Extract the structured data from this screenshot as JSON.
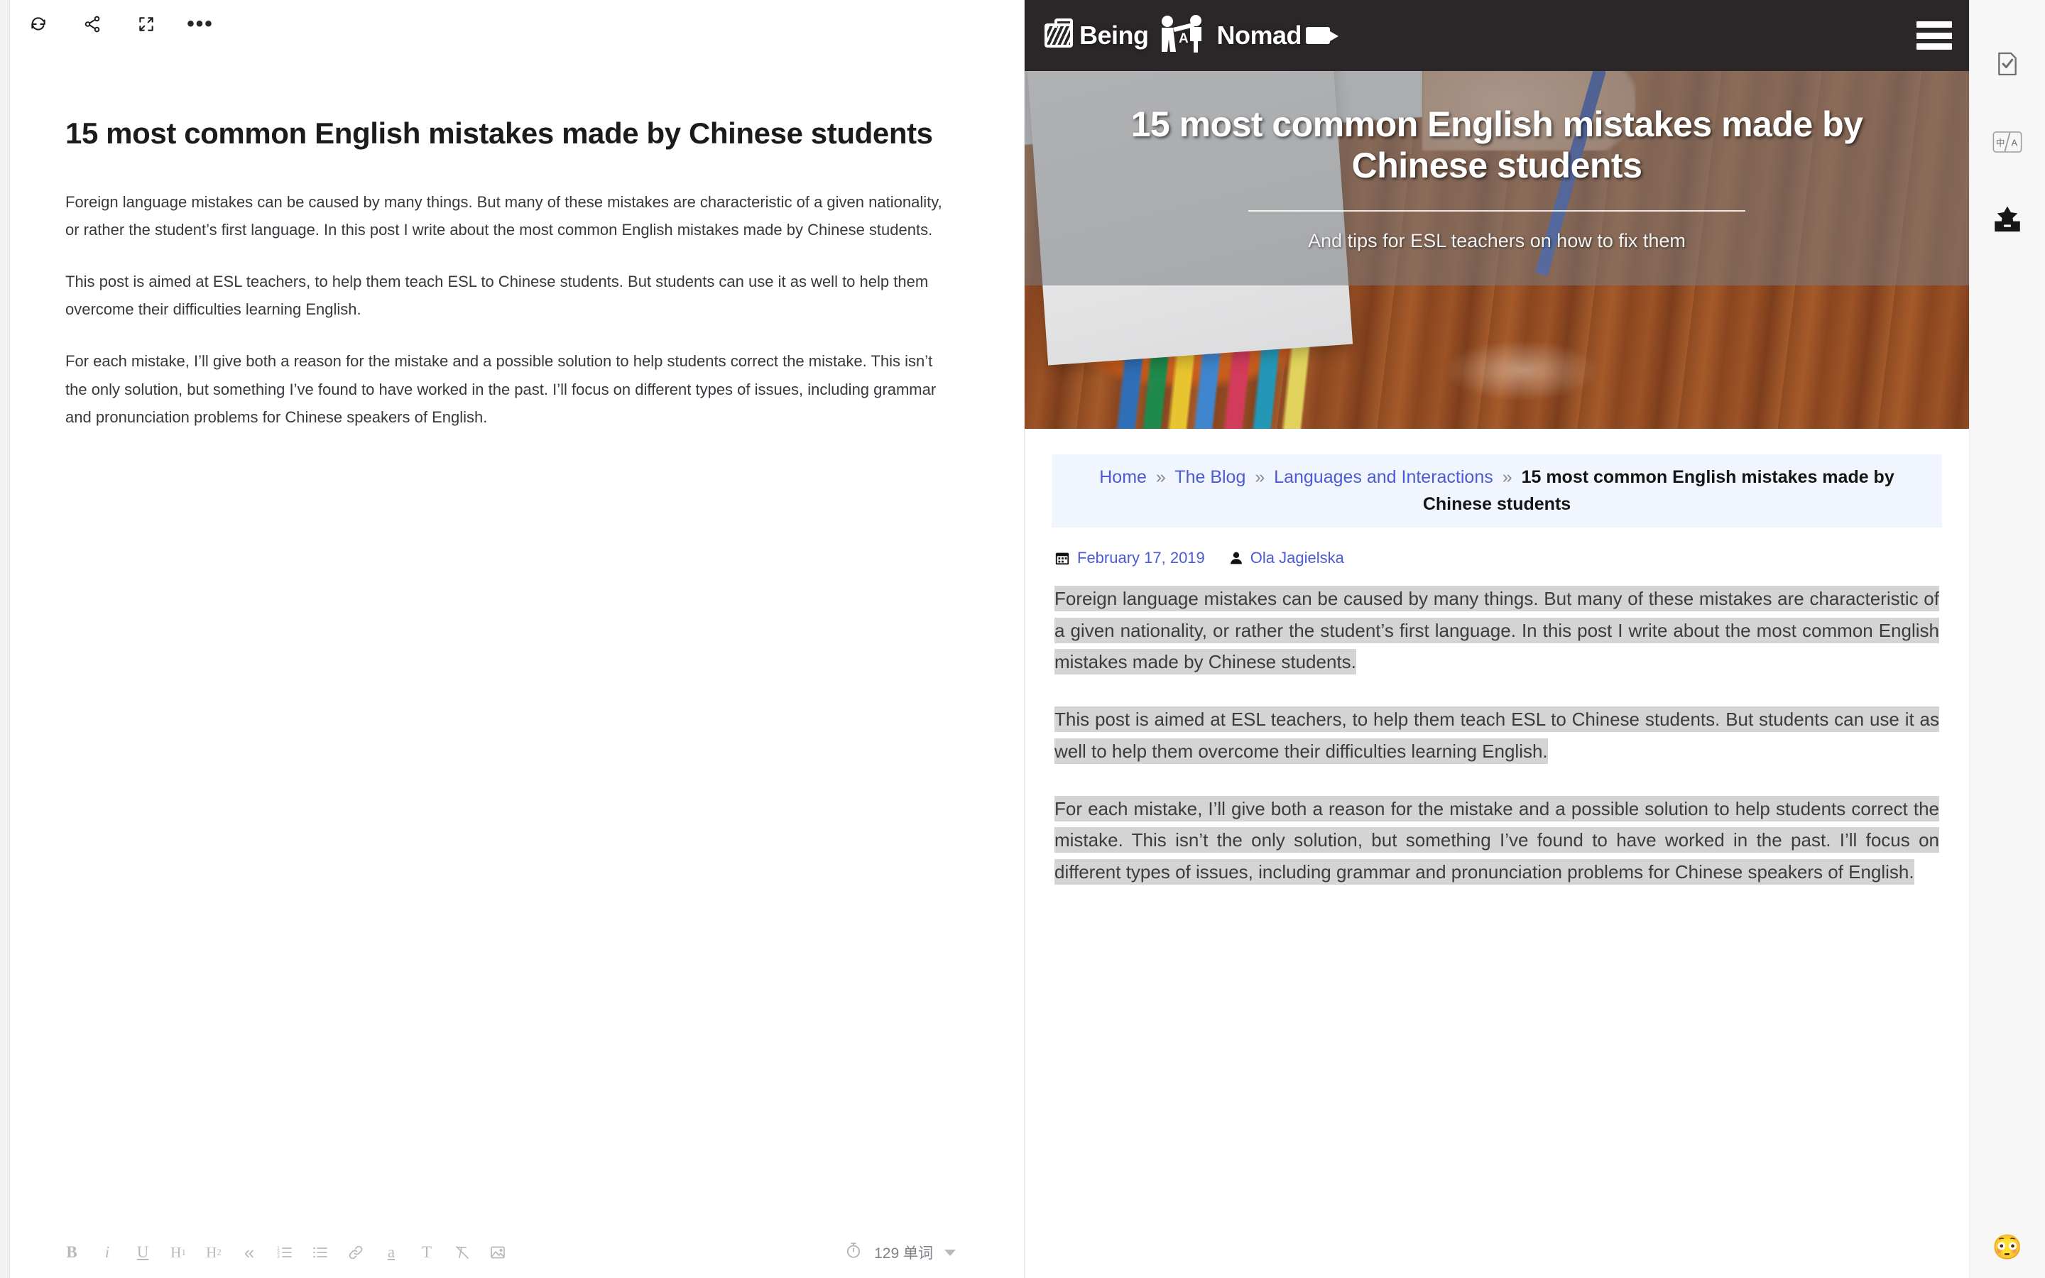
{
  "editor": {
    "toolbar": {
      "refresh_label": "sync",
      "share_label": "share",
      "fullscreen_label": "fullscreen",
      "more_label": "•••"
    },
    "title": "15 most common English mistakes made by Chinese students",
    "paragraphs": [
      "Foreign language mistakes can be caused by many things. But many of these mistakes are characteristic of a given nationality, or rather the student’s first language. In this post I write about the most common English mistakes made by Chinese students.",
      "This post is aimed at ESL teachers, to help them teach ESL to Chinese students. But students can use it as well to help them overcome their difficulties learning English.",
      "For each mistake, I’ll give both a reason for the mistake and a possible solution to help students correct the mistake. This isn’t the only solution, but something I’ve found to have worked in the past. I’ll focus on different types of issues, including grammar and pronunciation problems for Chinese speakers of English."
    ],
    "format_toolbar": [
      {
        "name": "bold",
        "label": "B"
      },
      {
        "name": "italic",
        "label": "i"
      },
      {
        "name": "underline",
        "label": "U"
      },
      {
        "name": "heading-1",
        "label": "H1"
      },
      {
        "name": "heading-2",
        "label": "H2"
      },
      {
        "name": "blockquote",
        "label": "«"
      },
      {
        "name": "ordered-list",
        "label": "ol"
      },
      {
        "name": "bullet-list",
        "label": "ul"
      },
      {
        "name": "link",
        "label": "link"
      },
      {
        "name": "highlight",
        "label": "a"
      },
      {
        "name": "text-style",
        "label": "T"
      },
      {
        "name": "clear-format",
        "label": "clear"
      },
      {
        "name": "insert-image",
        "label": "image"
      }
    ],
    "status": {
      "timer_label": "timer",
      "word_count": "129 单词"
    }
  },
  "site": {
    "logo_text_1": "Being",
    "logo_letter": "A",
    "logo_text_2": "Nomad",
    "menu_label": "menu",
    "hero": {
      "title": "15 most common English mistakes made by Chinese students",
      "subtitle": "And tips for ESL teachers on how to fix them"
    },
    "breadcrumb": {
      "items": [
        {
          "label": "Home",
          "link": true
        },
        {
          "label": "The Blog",
          "link": true
        },
        {
          "label": "Languages and Interactions",
          "link": true
        }
      ],
      "separator": "»",
      "current": "15 most common English mistakes made by Chinese students"
    },
    "meta": {
      "date": "February 17, 2019",
      "author": "Ola Jagielska"
    },
    "paragraphs": [
      "Foreign language mistakes can be caused by many things. But many of these mistakes are characteristic of a given nationality, or rather the student’s first language. In this post I write about the most common English mistakes made by Chinese students.",
      "This post is aimed at ESL teachers, to help them teach ESL to Chinese students. But students can use it as well to help them overcome their difficulties learning English.",
      "For each mistake, I’ll give both a reason for the mistake and a possible solution to help students correct the mistake. This isn’t the only solution, but something I’ve found to have worked in the past. I’ll focus on different types of issues, including grammar and pronunciation problems for Chinese speakers of English."
    ]
  },
  "right_rail": {
    "items": [
      {
        "name": "document-check-icon",
        "label": "proofread"
      },
      {
        "name": "translate-icon",
        "label": "中/A"
      },
      {
        "name": "archive-star-icon",
        "label": "collect"
      }
    ],
    "emoji": "😳"
  },
  "colors": {
    "accent_link": "#4b5bd6",
    "header_bg": "#2b2628",
    "breadcrumb_bg": "#f1f5fe",
    "selection": "#d4d4d4"
  }
}
